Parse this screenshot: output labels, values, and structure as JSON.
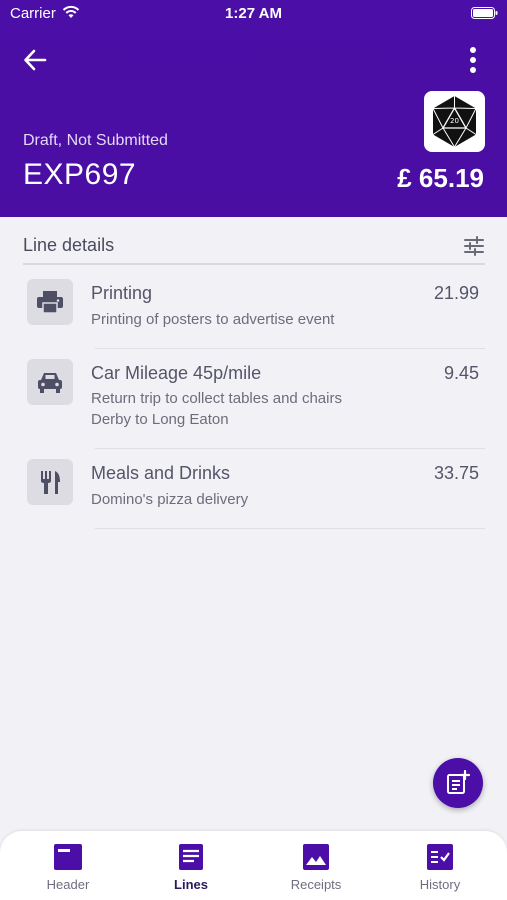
{
  "status_bar": {
    "carrier": "Carrier",
    "time": "1:27 AM"
  },
  "header": {
    "state": "Draft, Not Submitted",
    "reference": "EXP697",
    "total": "£ 65.19"
  },
  "section": {
    "title": "Line details"
  },
  "lines": [
    {
      "icon": "printer-icon",
      "title": "Printing",
      "amount": "21.99",
      "description": [
        "Printing of posters to advertise event"
      ]
    },
    {
      "icon": "car-icon",
      "title": "Car Mileage 45p/mile",
      "amount": "9.45",
      "description": [
        "Return trip to collect tables and chairs",
        "Derby to Long Eaton"
      ]
    },
    {
      "icon": "restaurant-icon",
      "title": "Meals and Drinks",
      "amount": "33.75",
      "description": [
        "Domino's pizza delivery"
      ]
    }
  ],
  "tabs": [
    {
      "label": "Header",
      "icon": "header-icon",
      "active": false
    },
    {
      "label": "Lines",
      "icon": "lines-icon",
      "active": true
    },
    {
      "label": "Receipts",
      "icon": "image-icon",
      "active": false
    },
    {
      "label": "History",
      "icon": "history-icon",
      "active": false
    }
  ],
  "colors": {
    "primary": "#4b0ea6",
    "background": "#f2f2f6",
    "icon_tile": "#dcdce2"
  }
}
